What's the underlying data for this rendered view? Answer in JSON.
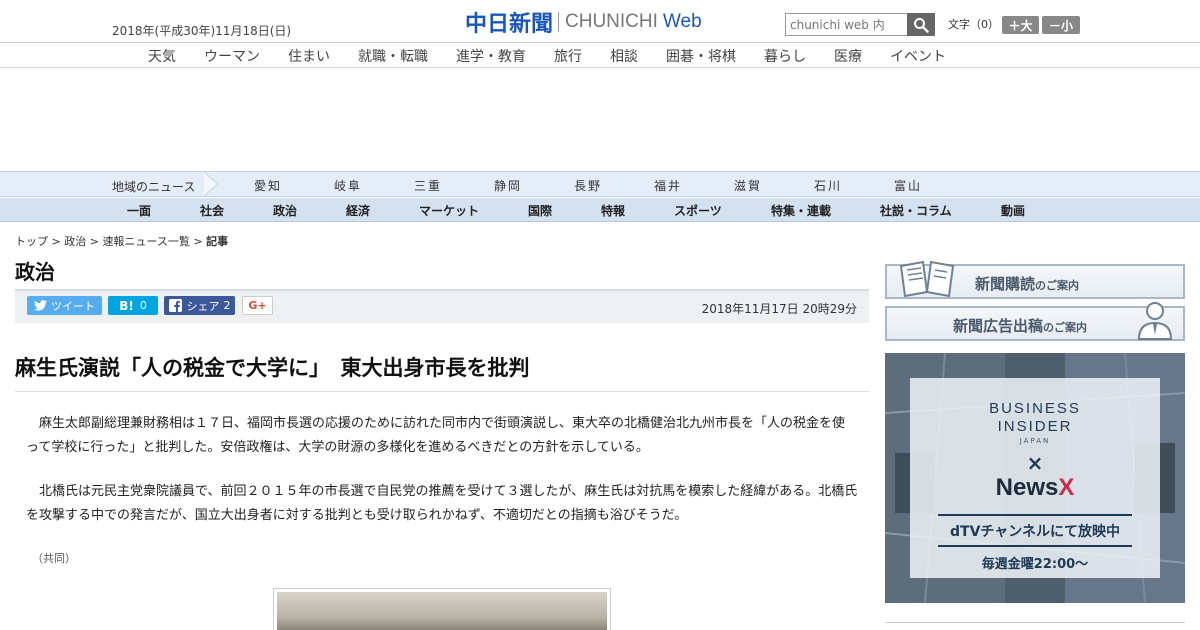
{
  "header": {
    "date": "2018年(平成30年)11月18日(日)",
    "logo_jp": "中日新聞",
    "logo_en": "CHUNICHI",
    "logo_web": "Web",
    "search_placeholder": "chunichi web 内",
    "text_size_label": "文字（0）",
    "bigger_label": "＋大",
    "smaller_label": "－小"
  },
  "category_nav": [
    "天気",
    "ウーマン",
    "住まい",
    "就職・転職",
    "進学・教育",
    "旅行",
    "相談",
    "囲碁・将棋",
    "暮らし",
    "医療",
    "イベント"
  ],
  "region_nav": {
    "label": "地域のニュース",
    "items": [
      "愛知",
      "岐阜",
      "三重",
      "静岡",
      "長野",
      "福井",
      "滋賀",
      "石川",
      "富山"
    ]
  },
  "main_nav": [
    "一面",
    "社会",
    "政治",
    "経済",
    "マーケット",
    "国際",
    "特報",
    "スポーツ",
    "特集・連載",
    "社説・コラム",
    "動画"
  ],
  "breadcrumb": {
    "items": [
      "トップ",
      "政治",
      "速報ニュース一覧"
    ],
    "separator": " > ",
    "current": "記事"
  },
  "section_title": "政治",
  "share": {
    "tweet": "ツイート",
    "hatena_count": "0",
    "share_label": "シェア",
    "share_count": "2",
    "gplus": "G+",
    "timestamp": "2018年11月17日 20時29分"
  },
  "article": {
    "headline": "麻生氏演説「人の税金で大学に」　東大出身市長を批判",
    "paragraphs": [
      "麻生太郎副総理兼財務相は１７日、福岡市長選の応援のために訪れた同市内で街頭演説し、東大卒の北橋健治北九州市長を「人の税金を使って学校に行った」と批判した。安倍政権は、大学の財源の多様化を進めるべきだとの方針を示している。",
      "北橋氏は元民主党衆院議員で、前回２０１５年の市長選で自民党の推薦を受けて３選したが、麻生氏は対抗馬を模索した経緯がある。北橋氏を攻撃する中での発言だが、国立大出身者に対する批判とも受け取られかねず、不適切だとの指摘も浴びそうだ。"
    ],
    "credit": "（共同）"
  },
  "sidebar": {
    "subscribe": "新聞購読",
    "subscribe_suffix": "のご案内",
    "advert": "新聞広告出稿",
    "advert_suffix": "のご案内"
  },
  "ad": {
    "line1": "BUSINESS",
    "line2": "INSIDER",
    "japan": "JAPAN",
    "cross": "×",
    "news_main": "News",
    "news_x": "X",
    "channel": "dTVチャンネルにて放映中",
    "schedule": "毎週金曜22:00〜"
  },
  "colors": {
    "logo_blue": "#1a56b8",
    "twitter": "#55acee",
    "hatena": "#00a4de",
    "facebook": "#3b5998",
    "gplus": "#dd4b39",
    "region_bg": "#e5eef8",
    "mainnav_bg": "#d4e1f1"
  }
}
